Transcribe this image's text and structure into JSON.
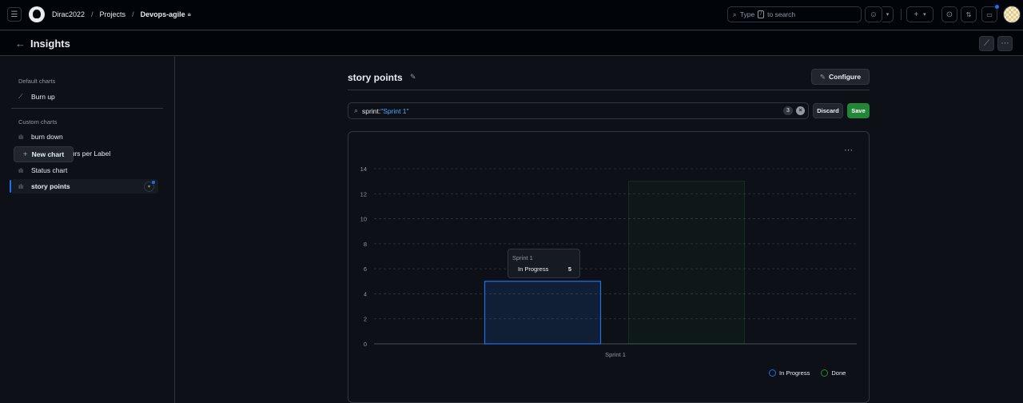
{
  "header": {
    "breadcrumbs": [
      "Dirac2022",
      "Projects",
      "Devops-agile"
    ],
    "search_label": "Type",
    "search_key": "/",
    "search_suffix": "to search"
  },
  "subheader": {
    "title": "Insights"
  },
  "sidebar": {
    "default_group": "Default charts",
    "default_items": [
      {
        "label": "Burn up",
        "icon": "trend-icon"
      }
    ],
    "custom_group": "Custom charts",
    "custom_items": [
      {
        "label": "burn down",
        "icon": "bar-chart-icon"
      },
      {
        "label": "Estimated hours per Label",
        "icon": "bar-chart-icon"
      },
      {
        "label": "Status chart",
        "icon": "bar-chart-icon"
      },
      {
        "label": "story points",
        "icon": "bar-chart-icon",
        "active": true
      }
    ],
    "new_chart_label": "New chart"
  },
  "main": {
    "title": "story points",
    "configure_label": "Configure",
    "filter_key": "sprint:",
    "filter_value": "\"Sprint 1\"",
    "filter_count": "3",
    "discard_label": "Discard",
    "save_label": "Save"
  },
  "tooltip": {
    "title": "Sprint 1",
    "series": "In Progress",
    "value": "5"
  },
  "colors": {
    "in_progress": "#1f6feb",
    "done": "#238636",
    "accent": "#1f6feb"
  },
  "chart_data": {
    "type": "bar",
    "categories": [
      "Sprint 1"
    ],
    "series": [
      {
        "name": "In Progress",
        "values": [
          5
        ],
        "color": "#1f6feb"
      },
      {
        "name": "Done",
        "values": [
          13
        ],
        "color": "#238636"
      }
    ],
    "ylim": [
      0,
      14
    ],
    "yticks": [
      0,
      2,
      4,
      6,
      8,
      10,
      12,
      14
    ],
    "grid": true,
    "legend_position": "bottom-right"
  }
}
